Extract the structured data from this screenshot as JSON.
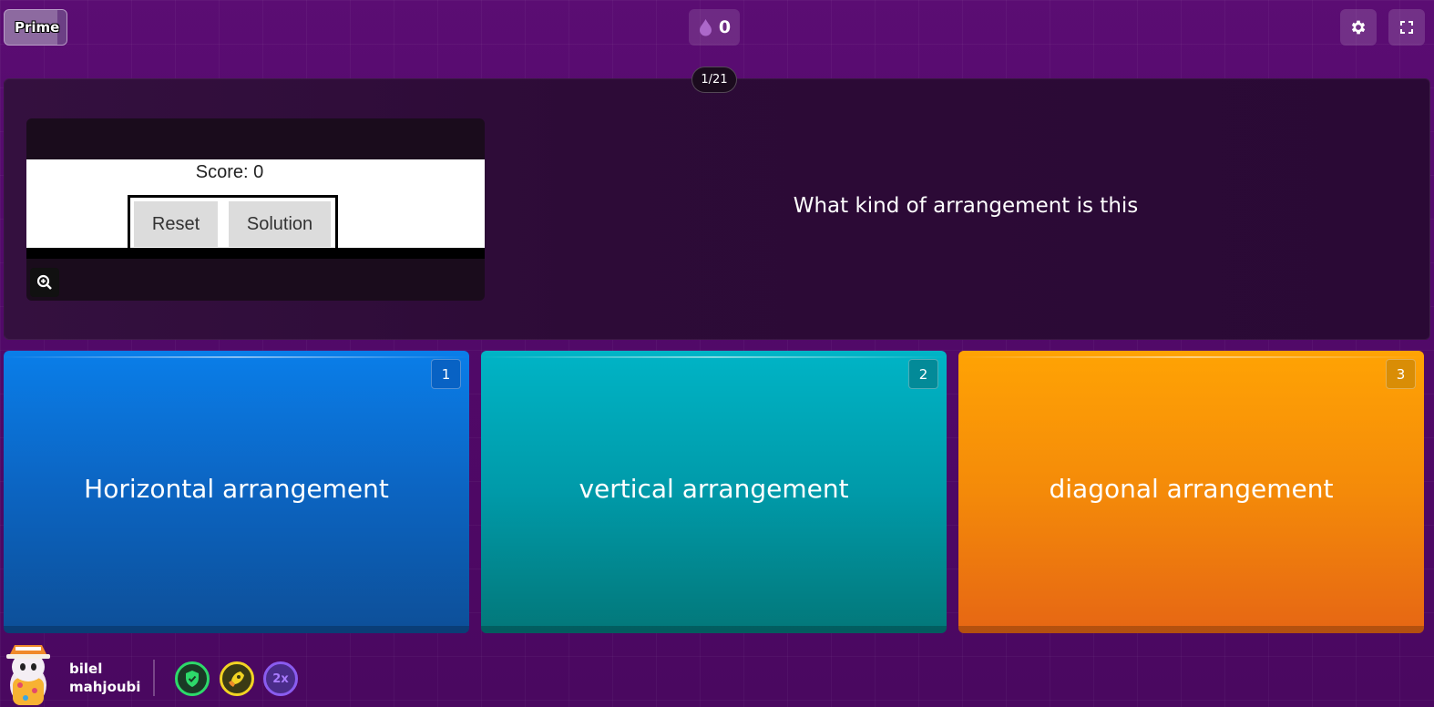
{
  "header": {
    "prime_label": "Prime",
    "drops_count": "0",
    "drops_icon": "drop-icon",
    "settings_icon": "gear-icon",
    "fullscreen_icon": "fullscreen-icon"
  },
  "question": {
    "counter": "1/21",
    "text": "What kind of arrangement is this",
    "image": {
      "score_text": "Score: 0",
      "reset_label": "Reset",
      "solution_label": "Solution",
      "zoom_icon": "zoom-in-icon"
    }
  },
  "answers": [
    {
      "label": "Horizontal arrangement",
      "number": "1",
      "color": "#0a7ee9"
    },
    {
      "label": "vertical arrangement",
      "number": "2",
      "color": "#00b4c6"
    },
    {
      "label": "diagonal arrangement",
      "number": "3",
      "color": "#ffa304"
    }
  ],
  "player": {
    "first_name": "bilel",
    "last_name": "mahjoubi",
    "powerups": [
      {
        "icon": "shield-icon",
        "color": "#2dd96a"
      },
      {
        "icon": "rocket-icon",
        "color": "#f2d323"
      },
      {
        "label": "2x",
        "color": "#8a5cf0"
      }
    ]
  }
}
